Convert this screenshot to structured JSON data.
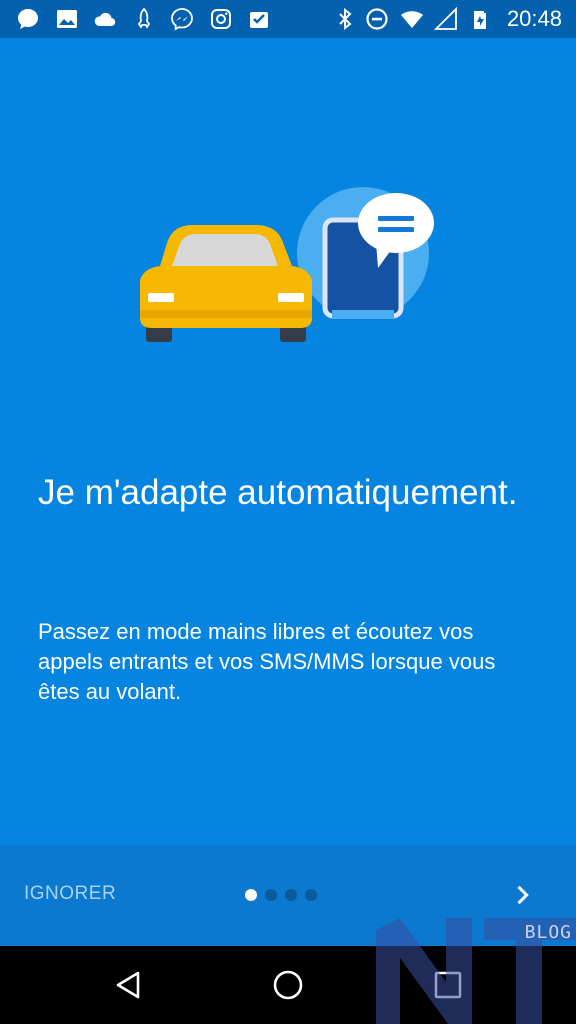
{
  "status_bar": {
    "time": "20:48",
    "left_icons": [
      "chat-bubble-icon",
      "image-icon",
      "cloud-icon",
      "rocket-icon",
      "messenger-icon",
      "instagram-icon",
      "clipboard-check-icon"
    ],
    "right_icons": [
      "bluetooth-icon",
      "do-not-disturb-icon",
      "wifi-icon",
      "signal-icon",
      "battery-charging-icon"
    ]
  },
  "onboarding": {
    "title": "Je m'adapte automatiquement.",
    "description": "Passez en mode mains libres et écoutez vos appels entrants et vos SMS/MMS lorsque vous êtes au volant.",
    "page_count": 4,
    "current_page": 1
  },
  "bottom_bar": {
    "skip_label": "IGNORER"
  },
  "watermark": {
    "label": "BLOG"
  },
  "colors": {
    "background": "#0584e0",
    "status_bar": "#0461b0",
    "car": "#f6b800",
    "phone_circle": "#4aaef0"
  }
}
